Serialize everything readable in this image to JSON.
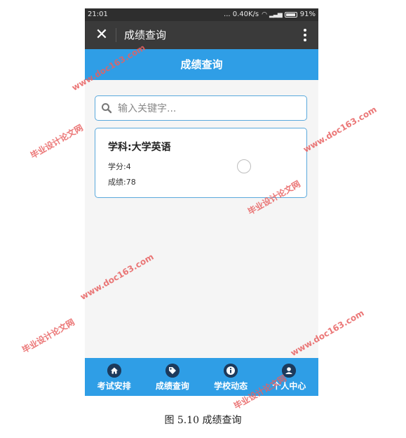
{
  "status_bar": {
    "time": "21:01",
    "network": "... 0.40K/s",
    "battery": "91%"
  },
  "title_bar": {
    "title": "成绩查询",
    "close_icon": "close-icon",
    "more_icon": "more-vertical-icon"
  },
  "header": {
    "title": "成绩查询"
  },
  "search": {
    "placeholder": "输入关键字..."
  },
  "card": {
    "title": "学科:大学英语",
    "credit": "学分:4",
    "score": "成绩:78"
  },
  "bottom_nav": {
    "items": [
      {
        "label": "考试安排",
        "icon": "home-icon"
      },
      {
        "label": "成绩查询",
        "icon": "tag-icon"
      },
      {
        "label": "学校动态",
        "icon": "info-icon"
      },
      {
        "label": "个人中心",
        "icon": "user-icon"
      }
    ]
  },
  "watermarks": {
    "site": "www.doc163.com",
    "name": "毕业设计论文网"
  },
  "caption": "图 5.10 成绩查询",
  "colors": {
    "accent": "#2f9ee6",
    "title_bar": "#3a3a3a",
    "watermark": "#e86060"
  }
}
